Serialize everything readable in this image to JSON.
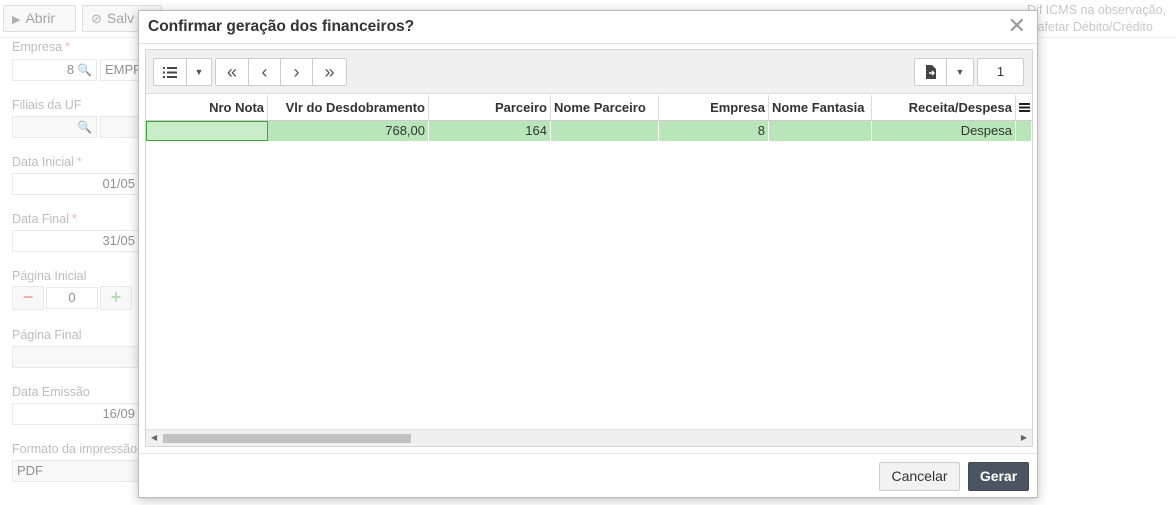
{
  "background": {
    "toolbar": {
      "open_label": "Abrir",
      "save_label": "Salv"
    },
    "note_line1": "Dif ICMS na observação,",
    "note_line2": "n afetar Débito/Crédito",
    "fields": {
      "empresa_label": "Empresa",
      "empresa_code": "8",
      "empresa_name": "EMPR",
      "filiais_label": "Filiais da UF",
      "data_inicial_label": "Data Inicial",
      "data_inicial_value": "01/05",
      "data_final_label": "Data Final",
      "data_final_value": "31/05",
      "pagina_inicial_label": "Página Inicial",
      "pagina_inicial_value": "0",
      "pagina_final_label": "Página Final",
      "data_emissao_label": "Data Emissão",
      "data_emissao_value": "16/09",
      "formato_label": "Formato da impressão",
      "formato_value": "PDF"
    }
  },
  "modal": {
    "title": "Confirmar geração dos financeiros?",
    "page_number": "1",
    "columns": [
      "Nro Nota",
      "Vlr do Desdobramento",
      "Parceiro",
      "Nome Parceiro",
      "Empresa",
      "Nome Fantasia",
      "Receita/Despesa"
    ],
    "rows": [
      [
        "",
        "768,00",
        "164",
        "",
        "8",
        "",
        "Despesa"
      ]
    ],
    "cancel_label": "Cancelar",
    "confirm_label": "Gerar"
  }
}
